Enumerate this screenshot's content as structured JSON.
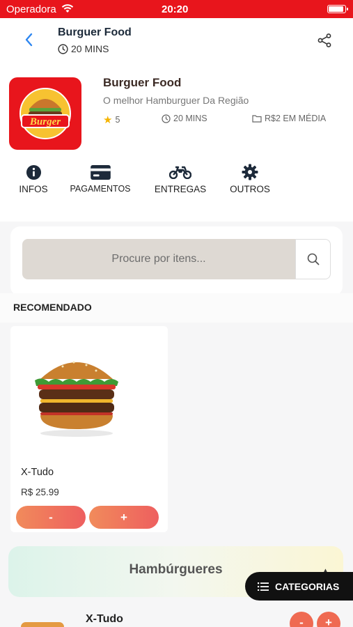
{
  "status_bar": {
    "carrier": "Operadora",
    "time": "20:20"
  },
  "header": {
    "title": "Burguer Food",
    "time": "20 MINS"
  },
  "store": {
    "name": "Burguer Food",
    "description": "O melhor Hamburguer Da Região",
    "logo_text": "Burger",
    "rating": "5",
    "delivery_time": "20 MINS",
    "average_price": "R$2 EM MÉDIA"
  },
  "actions": [
    {
      "label": "INFOS",
      "icon": "info-icon"
    },
    {
      "label": "PAGAMENTOS",
      "icon": "credit-card-icon"
    },
    {
      "label": "ENTREGAS",
      "icon": "motorcycle-icon"
    },
    {
      "label": "OUTROS",
      "icon": "gear-icon"
    }
  ],
  "search": {
    "placeholder": "Procure por itens..."
  },
  "recommended": {
    "title": "RECOMENDADO",
    "item": {
      "name": "X-Tudo",
      "price": "R$ 25.99",
      "minus": "-",
      "plus": "+"
    }
  },
  "category": {
    "title": "Hambúrgueres",
    "button_label": "CATEGORIAS"
  },
  "list_item": {
    "name": "X-Tudo",
    "minus": "-",
    "plus": "+"
  },
  "colors": {
    "brand_red": "#e8151c",
    "accent_blue": "#2d86f0",
    "button_orange": "#ef6a52"
  }
}
